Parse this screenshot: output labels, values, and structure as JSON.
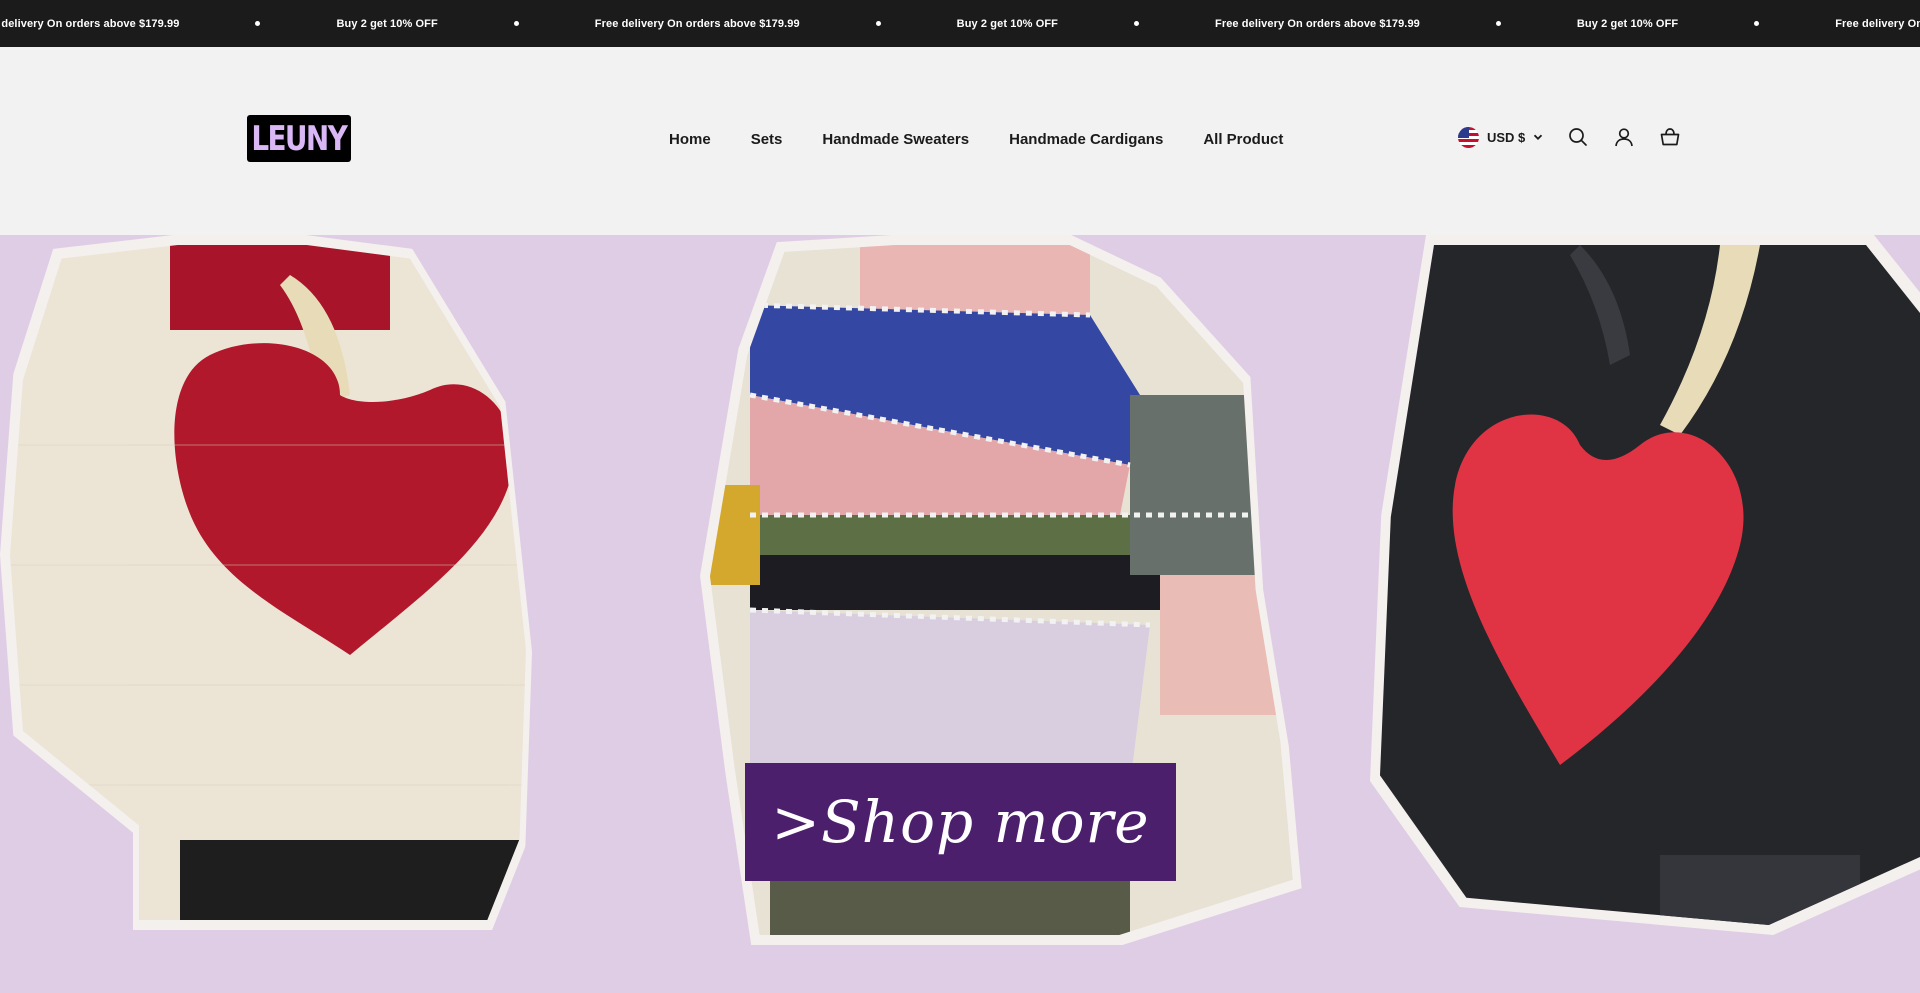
{
  "announcement": {
    "messages": [
      "e delivery On orders above $179.99",
      "Buy 2 get 10% OFF",
      "Free delivery On orders above $179.99",
      "Buy 2 get 10% OFF",
      "Free delivery On orders above $179.99",
      "Buy 2 get 10% OFF",
      "Free delivery On orders above"
    ]
  },
  "header": {
    "logo_text": "LEUNY",
    "nav": [
      "Home",
      "Sets",
      "Handmade Sweaters",
      "Handmade Cardigans",
      "All Product"
    ],
    "currency": "USD $",
    "icons": [
      "us-flag-icon",
      "chevron-down-icon",
      "search-icon",
      "account-icon",
      "cart-icon"
    ]
  },
  "hero": {
    "cta_label": ">Shop more",
    "images": [
      "cream sweater with red heart",
      "striped multicolor sweater",
      "black sweater with red heart"
    ]
  },
  "colors": {
    "announcement_bg": "#1b1b1b",
    "header_bg": "#f2f2f2",
    "hero_bg": "#dfcde5",
    "cta_bg": "#4c1f6d",
    "logo_text": "#d9b8f5"
  }
}
